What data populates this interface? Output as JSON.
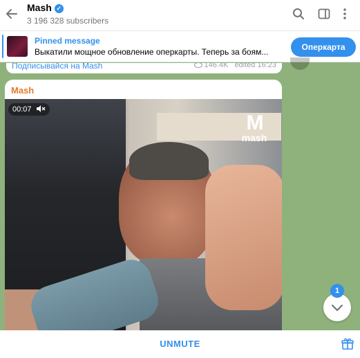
{
  "header": {
    "title": "Mash",
    "verified_glyph": "✓",
    "subscribers": "3 196 328 subscribers",
    "icons": [
      "back-arrow-icon",
      "search-icon",
      "sidebar-toggle-icon",
      "more-vertical-icon"
    ]
  },
  "pinned": {
    "title": "Pinned message",
    "text": "Выкатили мощное обновление оперкарты. Теперь за боям...",
    "button": "Оперкарта"
  },
  "previous_post": {
    "link": "Подписывайся на Mash",
    "views": "146.4K",
    "edited": "edited 16:23"
  },
  "message": {
    "author": "Mash",
    "author_color": "#e57a2a",
    "video_time": "00:07",
    "watermark_top": "M",
    "watermark_bottom": "mash"
  },
  "footer": {
    "unmute": "UNMUTE"
  },
  "scroll_badge": "1",
  "colors": {
    "accent": "#3390ec",
    "background": "#8fb27c"
  }
}
